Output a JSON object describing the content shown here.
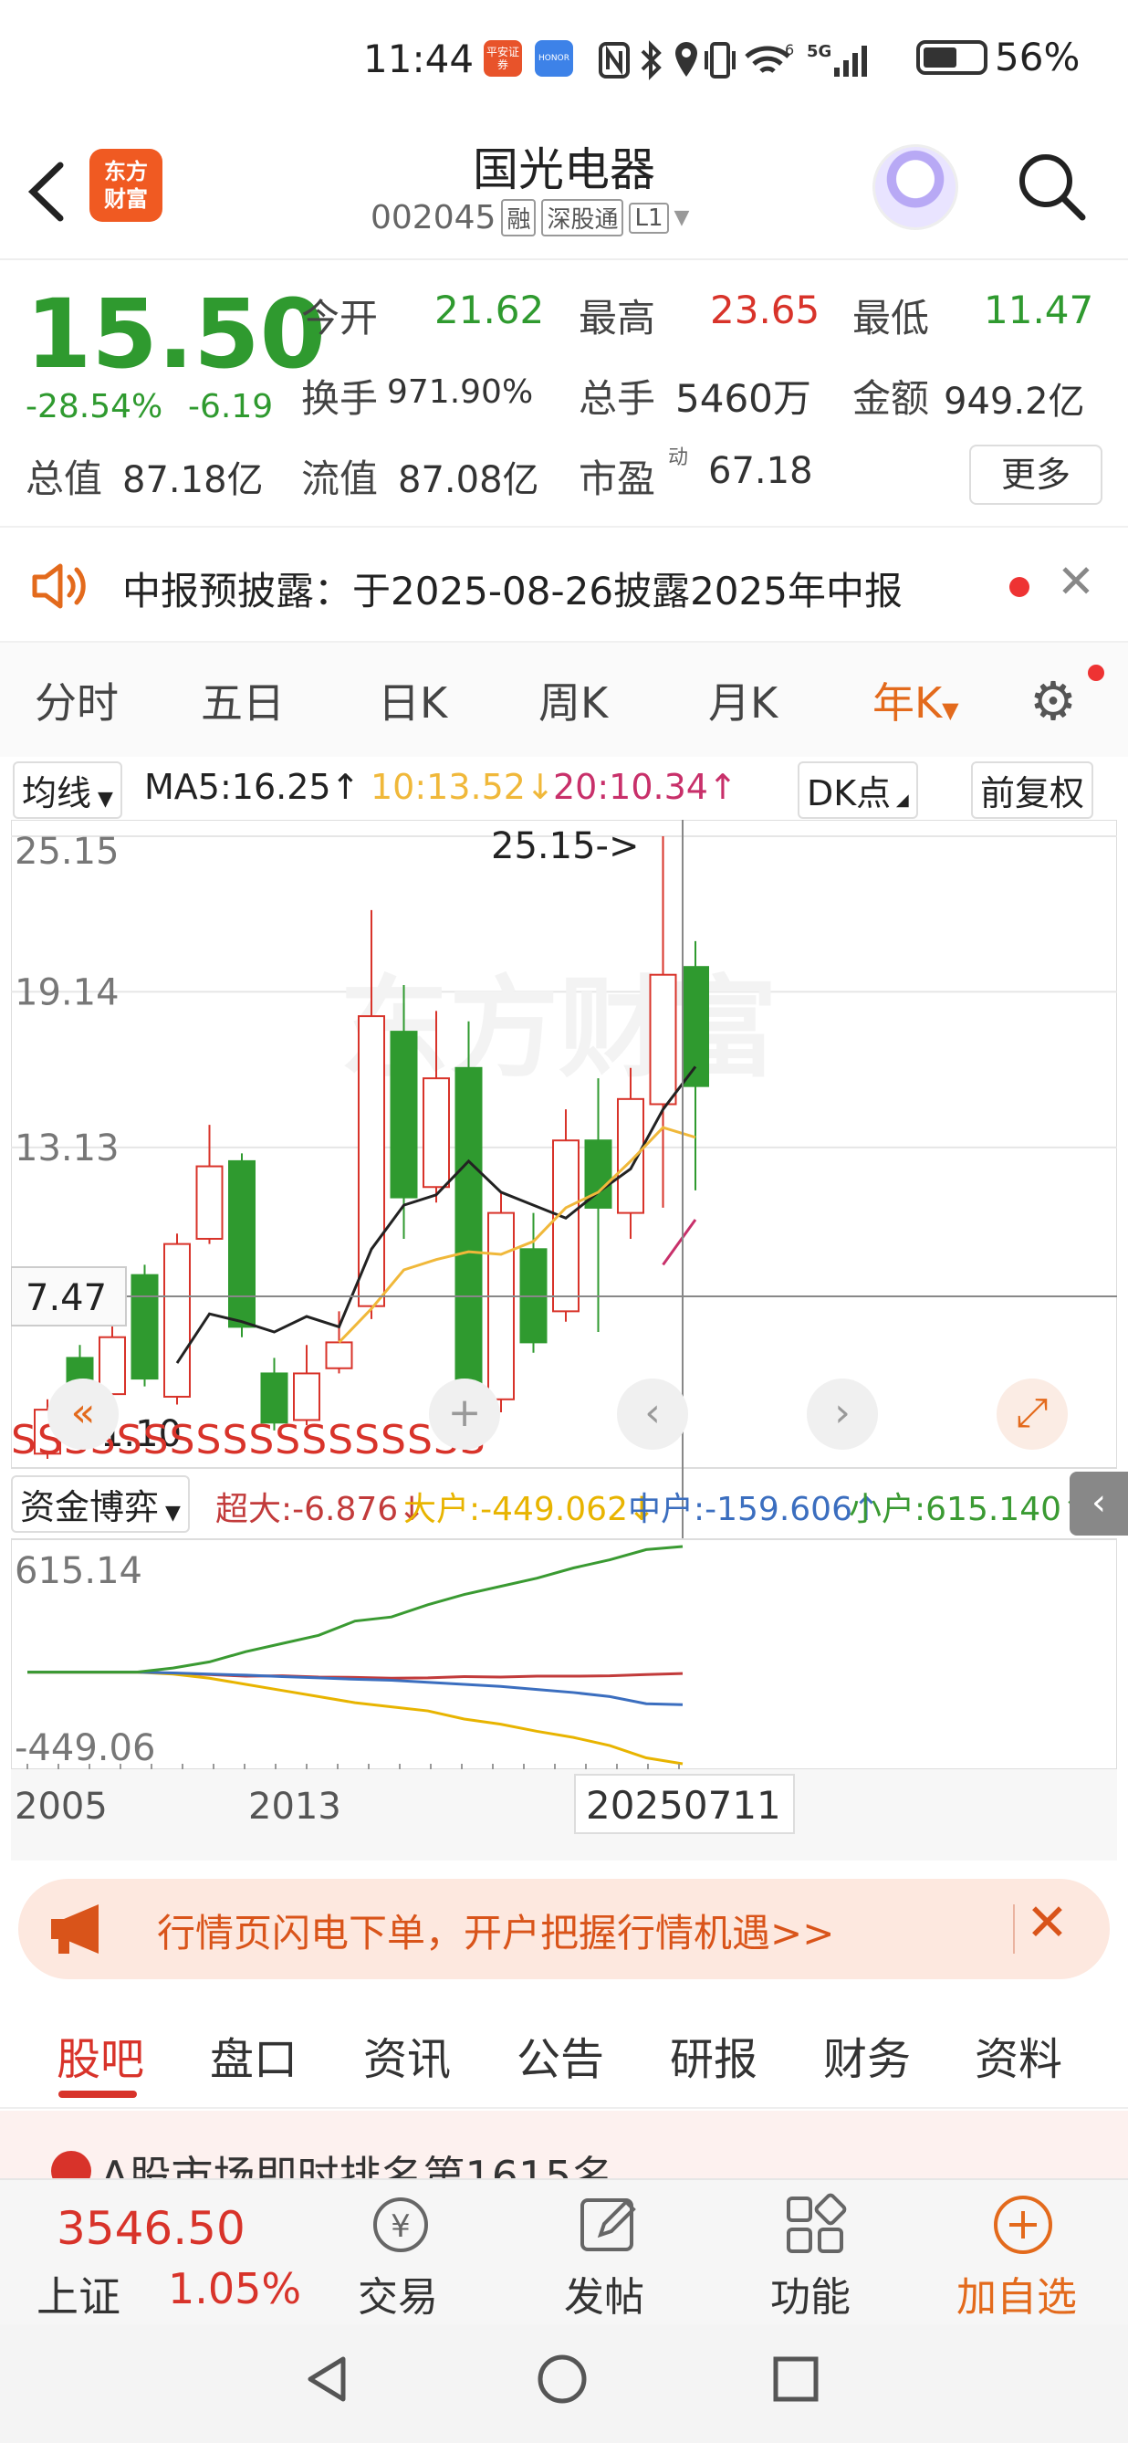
{
  "status_bar": {
    "time": "11:44",
    "app_icons": [
      "平安证券",
      "HONOR"
    ],
    "system_icons": [
      "nfc-icon",
      "bluetooth-icon",
      "location-icon",
      "vibrate-icon",
      "wifi-icon",
      "signal-5g-icon"
    ],
    "wifi_label": "6",
    "network": "5G",
    "battery": "56%"
  },
  "header": {
    "logo_line1": "东方",
    "logo_line2": "财富",
    "title": "国光电器",
    "code": "002045",
    "tags": [
      "融",
      "深股通",
      "L1"
    ]
  },
  "quote": {
    "price": "15.50",
    "change_pct": "-28.54%",
    "change": "-6.19",
    "open_label": "今开",
    "open": "21.62",
    "high_label": "最高",
    "high": "23.65",
    "low_label": "最低",
    "low": "11.47",
    "turnover_label": "换手",
    "turnover": "971.90%",
    "volume_label": "总手",
    "volume": "5460万",
    "amount_label": "金额",
    "amount": "949.2亿",
    "mktcap_label": "总值",
    "mktcap": "87.18亿",
    "float_label": "流值",
    "float": "87.08亿",
    "pe_label": "市盈",
    "pe_sup": "动",
    "pe": "67.18",
    "more": "更多"
  },
  "notice": {
    "text": "中报预披露：于2025-08-26披露2025年中报"
  },
  "tabs": {
    "items": [
      "分时",
      "五日",
      "日K",
      "周K",
      "月K",
      "年K"
    ],
    "active": "年K"
  },
  "ma_row": {
    "indicator": "均线",
    "ma5": "MA5:16.25↑",
    "ma10": "10:13.52↓",
    "ma20": "20:10.34↑",
    "dk": "DK点",
    "adjust": "前复权"
  },
  "chart_data": {
    "type": "candlestick",
    "y_ticks": [
      "25.15",
      "19.14",
      "13.13",
      "7.47"
    ],
    "max_marker": "25.15->",
    "min_marker": "<-1.10",
    "crosshair_value": "7.47",
    "signal_text": "SSSSSSSSSSSSSSSSSS",
    "ylim": [
      1.1,
      25.15
    ],
    "candles": [
      {
        "o": 1.3,
        "c": 3.0,
        "h": 3.4,
        "l": 1.1
      },
      {
        "o": 5.0,
        "c": 1.9,
        "h": 5.5,
        "l": 1.5
      },
      {
        "o": 3.6,
        "c": 5.8,
        "h": 7.2,
        "l": 3.4
      },
      {
        "o": 8.2,
        "c": 4.2,
        "h": 8.6,
        "l": 3.9
      },
      {
        "o": 3.5,
        "c": 9.4,
        "h": 9.8,
        "l": 3.2
      },
      {
        "o": 9.6,
        "c": 12.4,
        "h": 14.0,
        "l": 9.4
      },
      {
        "o": 12.6,
        "c": 6.2,
        "h": 12.9,
        "l": 5.8
      },
      {
        "o": 4.4,
        "c": 2.5,
        "h": 5.0,
        "l": 2.2
      },
      {
        "o": 2.6,
        "c": 4.4,
        "h": 5.5,
        "l": 2.4
      },
      {
        "o": 4.6,
        "c": 5.6,
        "h": 6.8,
        "l": 4.4
      },
      {
        "o": 7.0,
        "c": 18.2,
        "h": 22.3,
        "l": 6.5
      },
      {
        "o": 17.6,
        "c": 11.2,
        "h": 19.4,
        "l": 9.6
      },
      {
        "o": 11.6,
        "c": 15.8,
        "h": 18.4,
        "l": 11.0
      },
      {
        "o": 16.2,
        "c": 3.1,
        "h": 18.0,
        "l": 2.8
      },
      {
        "o": 3.4,
        "c": 10.6,
        "h": 11.4,
        "l": 2.9
      },
      {
        "o": 9.2,
        "c": 5.6,
        "h": 10.6,
        "l": 5.2
      },
      {
        "o": 6.8,
        "c": 13.4,
        "h": 14.6,
        "l": 6.4
      },
      {
        "o": 13.4,
        "c": 10.8,
        "h": 15.8,
        "l": 6.0
      },
      {
        "o": 10.6,
        "c": 15.0,
        "h": 16.2,
        "l": 9.6
      },
      {
        "o": 14.8,
        "c": 19.8,
        "h": 25.15,
        "l": 10.8
      },
      {
        "o": 20.1,
        "c": 15.5,
        "h": 21.1,
        "l": 11.47
      }
    ],
    "ma_lines": [
      {
        "name": "MA5",
        "color": "#222222",
        "values": [
          null,
          null,
          null,
          null,
          4.8,
          6.7,
          6.4,
          6.0,
          6.6,
          6.2,
          9.2,
          10.9,
          11.3,
          12.6,
          11.4,
          10.9,
          10.4,
          11.4,
          12.3,
          14.6,
          16.25
        ]
      },
      {
        "name": "MA10",
        "color": "#f0b83a",
        "values": [
          null,
          null,
          null,
          null,
          null,
          null,
          null,
          null,
          null,
          5.6,
          6.9,
          8.4,
          8.8,
          9.1,
          9.0,
          9.5,
          10.8,
          11.4,
          12.6,
          13.9,
          13.52
        ]
      },
      {
        "name": "MA20",
        "color": "#c8306a",
        "values": [
          null,
          null,
          null,
          null,
          null,
          null,
          null,
          null,
          null,
          null,
          null,
          null,
          null,
          null,
          null,
          null,
          null,
          null,
          null,
          8.6,
          10.34
        ]
      }
    ],
    "fund_flow": {
      "ylim": [
        -449.06,
        615.14
      ],
      "y_ticks": [
        "615.14",
        "-449.06"
      ],
      "series": [
        {
          "name": "超大",
          "color": "#c23b3b",
          "values": [
            0,
            0,
            0,
            0,
            -5,
            -12,
            -20,
            -18,
            -24,
            -26,
            -30,
            -28,
            -22,
            -24,
            -20,
            -20,
            -18,
            -12,
            -6.876
          ]
        },
        {
          "name": "大户",
          "color": "#e8b400",
          "values": [
            0,
            0,
            0,
            0,
            -10,
            -30,
            -60,
            -90,
            -120,
            -150,
            -170,
            -190,
            -230,
            -255,
            -290,
            -320,
            -360,
            -420,
            -449.062
          ]
        },
        {
          "name": "中户",
          "color": "#3b6ebf",
          "values": [
            0,
            0,
            0,
            0,
            -4,
            -10,
            -15,
            -22,
            -28,
            -35,
            -40,
            -50,
            -60,
            -70,
            -85,
            -100,
            -120,
            -155,
            -159.606
          ]
        },
        {
          "name": "小户",
          "color": "#3a9a32",
          "values": [
            0,
            0,
            0,
            0,
            20,
            50,
            100,
            140,
            180,
            250,
            270,
            330,
            380,
            420,
            460,
            510,
            550,
            600,
            615.14
          ]
        }
      ]
    },
    "x_labels": [
      "2005",
      "2013",
      "20250711"
    ]
  },
  "fund_row": {
    "indicator": "资金博弈",
    "super": "超大:-6.876↓",
    "large": "大户:-449.062↓",
    "medium": "中户:-159.606↑",
    "small": "小户:615.140↑"
  },
  "ad": {
    "text": "行情页闪电下单，开户把握行情机遇>>"
  },
  "sub_tabs": {
    "items": [
      "股吧",
      "盘口",
      "资讯",
      "公告",
      "研报",
      "财务",
      "资料"
    ],
    "active": "股吧"
  },
  "feed": {
    "partial_text": "A股市场即时排名第1615名"
  },
  "toolbar": {
    "index_value": "3546.50",
    "index_name": "上证",
    "index_change": "1.05%",
    "items": [
      "交易",
      "发帖",
      "功能",
      "加自选"
    ]
  },
  "colors": {
    "up": "#d8332a",
    "down": "#2f9a2f",
    "accent": "#e36a1c"
  }
}
